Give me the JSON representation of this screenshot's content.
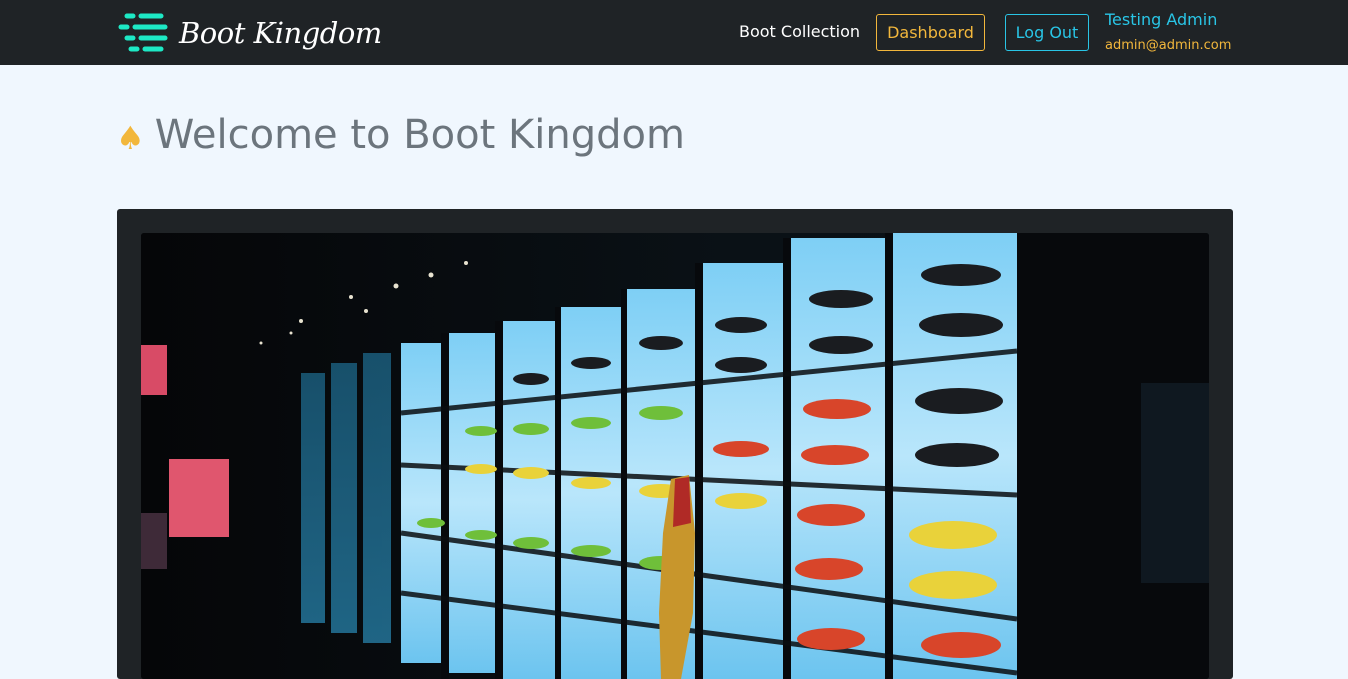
{
  "brand": {
    "name": "Boot Kingdom",
    "logo_icon": "list-lines-icon",
    "accent": "#1de9c5"
  },
  "nav": {
    "collection_label": "Boot Collection",
    "dashboard_label": "Dashboard",
    "logout_label": "Log Out",
    "user_name": "Testing Admin",
    "user_email": "admin@admin.com"
  },
  "page": {
    "title": "Welcome to Boot Kingdom",
    "title_icon": "spade-icon"
  },
  "colors": {
    "navbar": "#1f2326",
    "background": "#f0f7fe",
    "gold": "#f2b73c",
    "cyan": "#29c5e6"
  }
}
